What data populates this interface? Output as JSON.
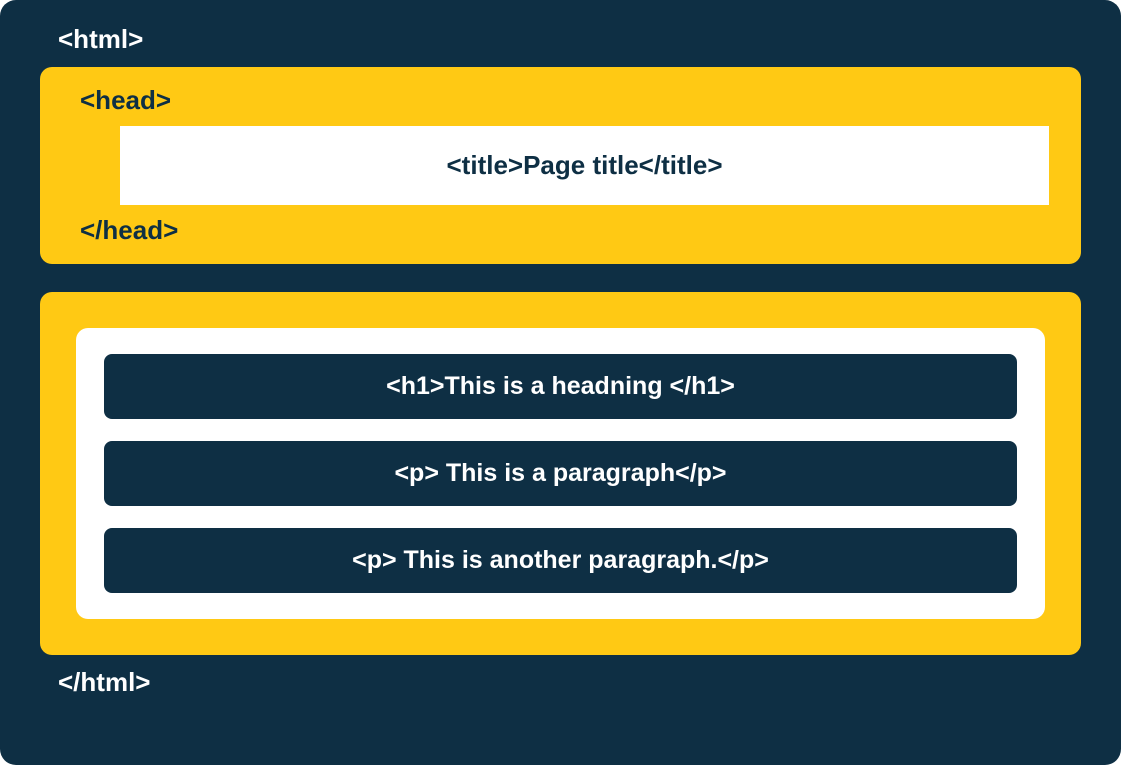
{
  "html_open": "<html>",
  "html_close": "</html>",
  "head": {
    "open": "<head>",
    "close": "</head>",
    "title": "<title>Page title</title>"
  },
  "body": {
    "rows": [
      "<h1>This is a headning </h1>",
      "<p> This is a paragraph</p>",
      "<p> This is another paragraph.</p>"
    ]
  },
  "colors": {
    "dark_navy": "#0e2f44",
    "yellow": "#ffc914",
    "white": "#ffffff"
  }
}
